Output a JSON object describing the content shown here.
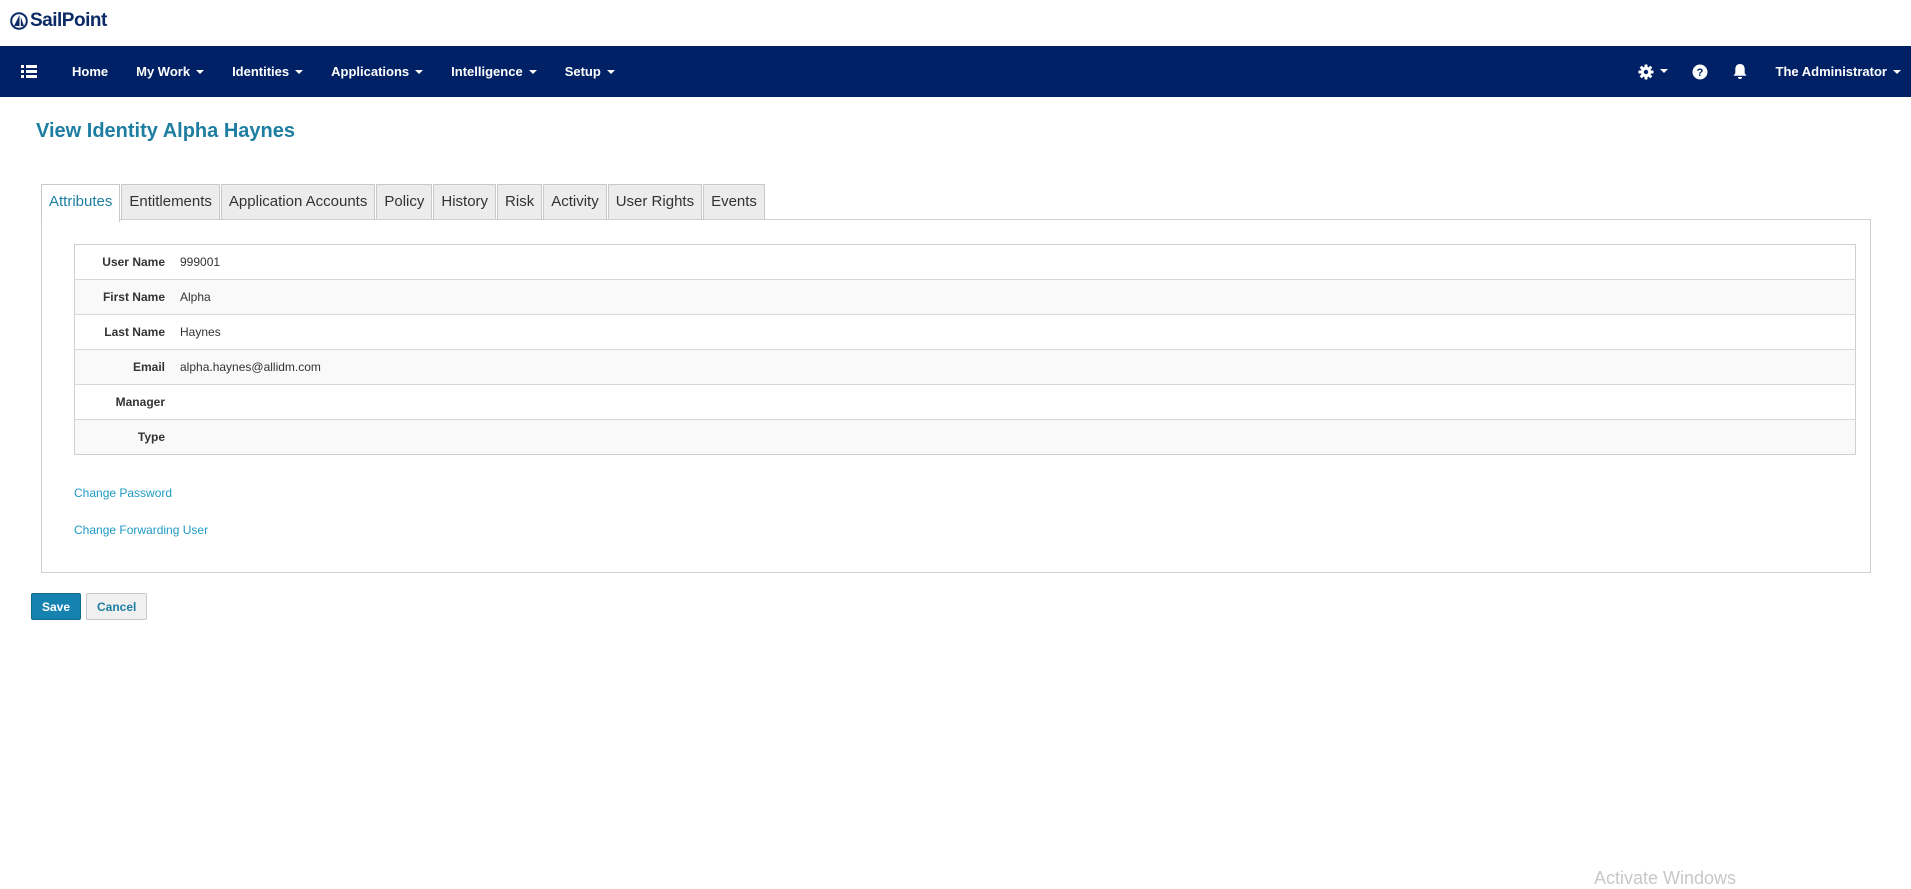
{
  "logo": {
    "text": "SailPoint"
  },
  "nav": {
    "items": [
      {
        "label": "Home",
        "dropdown": false
      },
      {
        "label": "My Work",
        "dropdown": true
      },
      {
        "label": "Identities",
        "dropdown": true
      },
      {
        "label": "Applications",
        "dropdown": true
      },
      {
        "label": "Intelligence",
        "dropdown": true
      },
      {
        "label": "Setup",
        "dropdown": true
      }
    ],
    "user": "The Administrator"
  },
  "page": {
    "title": "View Identity Alpha Haynes"
  },
  "tabs": [
    {
      "label": "Attributes",
      "active": true
    },
    {
      "label": "Entitlements"
    },
    {
      "label": "Application Accounts"
    },
    {
      "label": "Policy"
    },
    {
      "label": "History"
    },
    {
      "label": "Risk"
    },
    {
      "label": "Activity"
    },
    {
      "label": "User Rights"
    },
    {
      "label": "Events"
    }
  ],
  "attributes": [
    {
      "label": "User Name",
      "value": "999001"
    },
    {
      "label": "First Name",
      "value": "Alpha"
    },
    {
      "label": "Last Name",
      "value": "Haynes"
    },
    {
      "label": "Email",
      "value": "alpha.haynes@allidm.com"
    },
    {
      "label": "Manager",
      "value": ""
    },
    {
      "label": "Type",
      "value": ""
    }
  ],
  "links": {
    "change_password": "Change Password",
    "change_forwarding": "Change Forwarding User"
  },
  "buttons": {
    "save": "Save",
    "cancel": "Cancel"
  },
  "watermark": "Activate Windows",
  "colors": {
    "navbar": "#002165",
    "accent": "#1e7ea1",
    "link": "#1e9ac5",
    "save_button": "#1582b0"
  }
}
